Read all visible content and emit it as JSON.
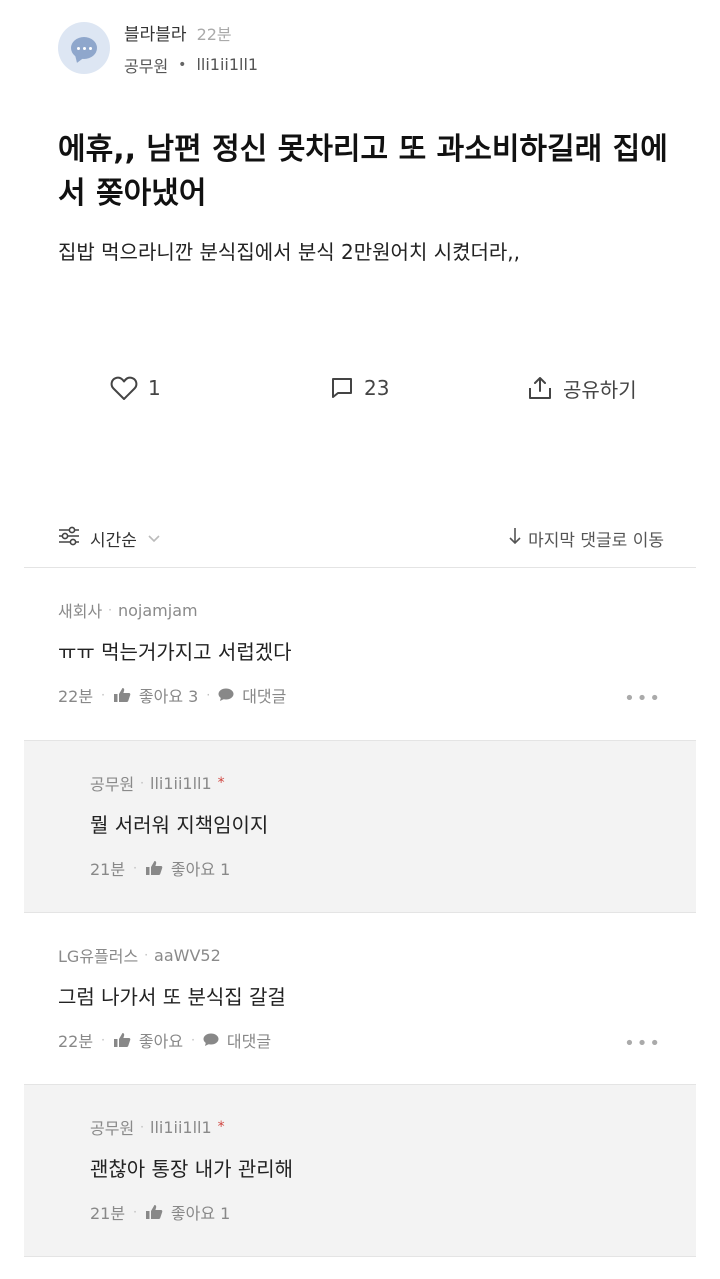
{
  "post": {
    "channel": "블라블라",
    "time": "22분",
    "company": "공무원",
    "separator": "•",
    "author": "lli1ii1ll1",
    "title": "에휴,, 남편 정신 못차리고 또 과소비하길래 집에서 쫒아냈어",
    "body": "집밥 먹으라니깐 분식집에서 분식 2만원어치 시켰더라,,"
  },
  "actions": {
    "like_count": "1",
    "comment_count": "23",
    "share_label": "공유하기"
  },
  "sort": {
    "label": "시간순",
    "jump_label": "마지막 댓글로 이동"
  },
  "comments": [
    {
      "company": "새회사",
      "author": "nojamjam",
      "text": "ㅠㅠ 먹는거가지고 서럽겠다",
      "time": "22분",
      "like_label": "좋아요 3",
      "reply_label": "대댓글",
      "more": "•••"
    },
    {
      "company": "공무원",
      "author": "lli1ii1ll1",
      "badge": "*",
      "text": "뭘 서러워 지책임이지",
      "time": "21분",
      "like_label": "좋아요 1"
    },
    {
      "company": "LG유플러스",
      "author": "aaWV52",
      "text": "그럼 나가서 또 분식집 갈걸",
      "time": "22분",
      "like_label": "좋아요",
      "reply_label": "대댓글",
      "more": "•••"
    },
    {
      "company": "공무원",
      "author": "lli1ii1ll1",
      "badge": "*",
      "text": "괜찮아 통장 내가 관리해",
      "time": "21분",
      "like_label": "좋아요 1"
    }
  ],
  "meta_dot": "·",
  "colors": {
    "avatar_bg": "#dde6f3",
    "avatar_fg": "#8fa7cc",
    "reply_bg": "#f3f3f3",
    "badge": "#d0453f"
  }
}
